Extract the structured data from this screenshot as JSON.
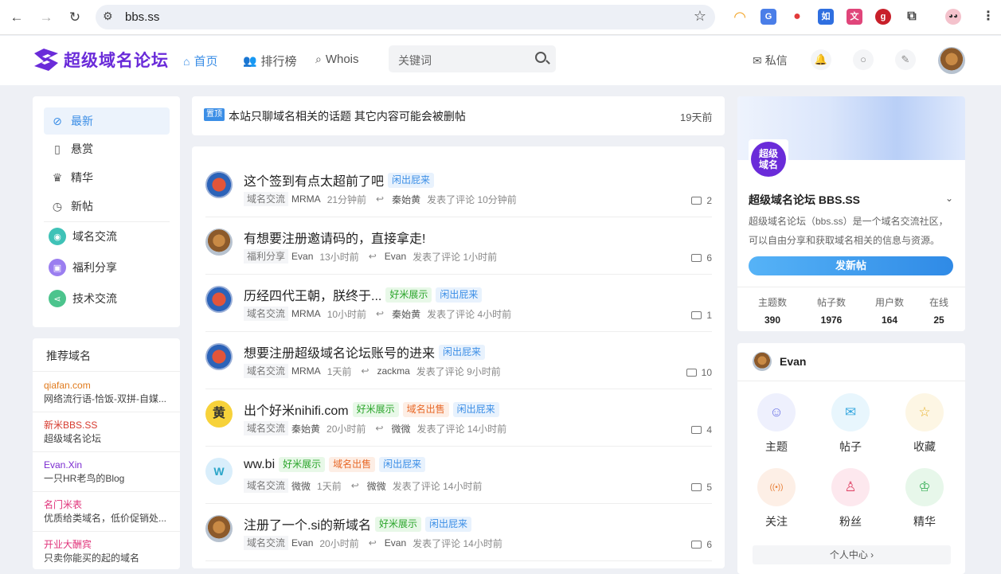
{
  "browser": {
    "url": "bbs.ss"
  },
  "site": {
    "logo_text": "超级域名论坛",
    "nav": {
      "home": "首页",
      "ranking": "排行榜",
      "whois": "Whois"
    },
    "search_placeholder": "关键词",
    "messages": "私信"
  },
  "left_nav": {
    "items": [
      {
        "label": "最新",
        "icon": "compass-icon"
      },
      {
        "label": "悬赏",
        "icon": "trash-icon"
      },
      {
        "label": "精华",
        "icon": "crown-icon"
      },
      {
        "label": "新帖",
        "icon": "clock-icon"
      }
    ],
    "categories": [
      {
        "label": "域名交流",
        "color": "#3fc2b7"
      },
      {
        "label": "福利分享",
        "color": "#9b7ef0"
      },
      {
        "label": "技术交流",
        "color": "#4cc48d"
      }
    ]
  },
  "recommend": {
    "title": "推荐域名",
    "items": [
      {
        "name": "qiafan.com",
        "desc": "网络流行语-恰饭-双拼-自媒...",
        "color": "#e07a1c"
      },
      {
        "name": "新米BBS.SS",
        "desc": "超级域名论坛",
        "color": "#d63a2e"
      },
      {
        "name": "Evan.Xin",
        "desc": "一只HR老鸟的Blog",
        "color": "#7a2bd0"
      },
      {
        "name": "名门米表",
        "desc": "优质给类域名，低价促销处...",
        "color": "#e0337a"
      },
      {
        "name": "开业大酬宾",
        "desc": "只卖你能买的起的域名",
        "color": "#e0337a"
      }
    ]
  },
  "pinned": {
    "badge": "置顶",
    "text": "本站只聊域名相关的话题 其它内容可能会被删帖",
    "time": "19天前"
  },
  "posts": [
    {
      "title": "这个签到有点太超前了吧",
      "tags": [
        {
          "t": "闲出屁来",
          "c": "blue"
        }
      ],
      "cat": "域名交流",
      "author": "MRMA",
      "time": "21分钟前",
      "replier": "秦始黄",
      "reply_time": "发表了评论 10分钟前",
      "comments": "2"
    },
    {
      "title": "有想要注册邀请码的，直接拿走!",
      "tags": [],
      "cat": "福利分享",
      "author": "Evan",
      "time": "13小时前",
      "replier": "Evan",
      "reply_time": "发表了评论 1小时前",
      "comments": "6"
    },
    {
      "title": "历经四代王朝，朕终于...",
      "tags": [
        {
          "t": "好米展示",
          "c": "green"
        },
        {
          "t": "闲出屁来",
          "c": "blue"
        }
      ],
      "cat": "域名交流",
      "author": "MRMA",
      "time": "10小时前",
      "replier": "秦始黄",
      "reply_time": "发表了评论 4小时前",
      "comments": "1"
    },
    {
      "title": "想要注册超级域名论坛账号的进来",
      "tags": [
        {
          "t": "闲出屁来",
          "c": "blue"
        }
      ],
      "cat": "域名交流",
      "author": "MRMA",
      "time": "1天前",
      "replier": "zackma",
      "reply_time": "发表了评论 9小时前",
      "comments": "10"
    },
    {
      "title": "出个好米nihifi.com",
      "tags": [
        {
          "t": "好米展示",
          "c": "green"
        },
        {
          "t": "域名出售",
          "c": "orange"
        },
        {
          "t": "闲出屁来",
          "c": "blue"
        }
      ],
      "cat": "域名交流",
      "author": "秦始黄",
      "time": "20小时前",
      "replier": "微微",
      "reply_time": "发表了评论 14小时前",
      "comments": "4"
    },
    {
      "title": "ww.bi",
      "tags": [
        {
          "t": "好米展示",
          "c": "green"
        },
        {
          "t": "域名出售",
          "c": "orange"
        },
        {
          "t": "闲出屁来",
          "c": "blue"
        }
      ],
      "cat": "域名交流",
      "author": "微微",
      "time": "1天前",
      "replier": "微微",
      "reply_time": "发表了评论 14小时前",
      "comments": "5"
    },
    {
      "title": "注册了一个.si的新域名",
      "tags": [
        {
          "t": "好米展示",
          "c": "green"
        },
        {
          "t": "闲出屁来",
          "c": "blue"
        }
      ],
      "cat": "域名交流",
      "author": "Evan",
      "time": "20小时前",
      "replier": "Evan",
      "reply_time": "发表了评论 14小时前",
      "comments": "6"
    }
  ],
  "sidebar": {
    "logo_text": "超级域名",
    "name": "超级域名论坛 BBS.SS",
    "desc": "超级域名论坛（bbs.ss）是一个域名交流社区，可以自由分享和获取域名相关的信息与资源。",
    "new_post": "发新帖",
    "stats": [
      {
        "label": "主题数",
        "value": "390"
      },
      {
        "label": "帖子数",
        "value": "1976"
      },
      {
        "label": "用户数",
        "value": "164"
      },
      {
        "label": "在线",
        "value": "25"
      }
    ],
    "user": "Evan",
    "quick": [
      {
        "label": "主题",
        "icon": "chat-bubble-icon",
        "bg": "#eef0fd",
        "fg": "#6b73e6"
      },
      {
        "label": "帖子",
        "icon": "chat-bubbles-icon",
        "bg": "#e8f6fd",
        "fg": "#3aa9e0"
      },
      {
        "label": "收藏",
        "icon": "star-icon",
        "bg": "#fdf6e4",
        "fg": "#e6b12a"
      },
      {
        "label": "关注",
        "icon": "broadcast-icon",
        "bg": "#fdefe6",
        "fg": "#e8803a"
      },
      {
        "label": "粉丝",
        "icon": "user-icon",
        "bg": "#fde8ee",
        "fg": "#e04a6b"
      },
      {
        "label": "精华",
        "icon": "crown-icon",
        "bg": "#e7f7ea",
        "fg": "#3cb05a"
      }
    ],
    "user_center": "个人中心"
  }
}
